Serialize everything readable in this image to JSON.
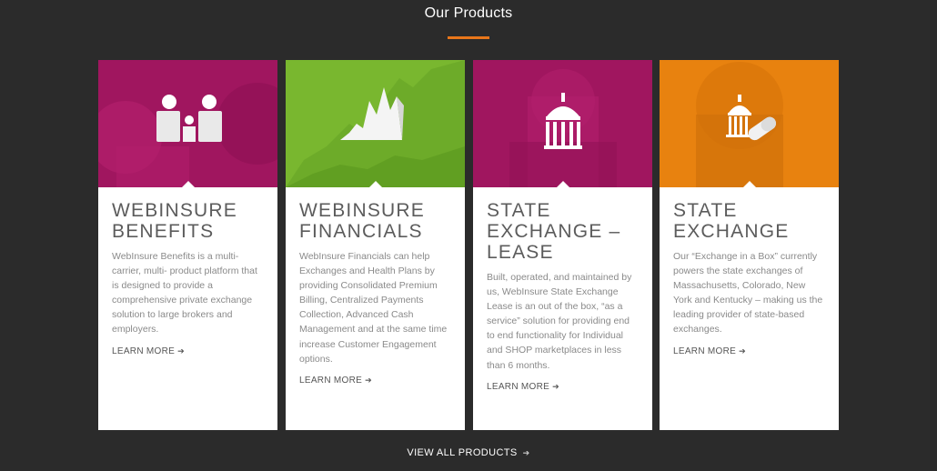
{
  "section": {
    "title": "Our Products",
    "accent_color": "#e8761a"
  },
  "cards": [
    {
      "title": "WEBINSURE\nBENEFITS",
      "description": "WebInsure Benefits is a multi-carrier, multi- product platform that is designed to provide a comprehensive private exchange solution to large brokers and employers.",
      "link_label": "LEARN MORE",
      "icon": "family-icon",
      "hero_color": "#a0165f"
    },
    {
      "title": "WEBINSURE\nFINANCIALS",
      "description": "WebInsure Financials can help Exchanges and Health Plans by providing Consolidated Premium Billing, Centralized Payments Collection, Advanced Cash Management and at the same time increase Customer Engagement options.",
      "link_label": "LEARN MORE",
      "icon": "chart-icon",
      "hero_color": "#79b72f"
    },
    {
      "title": "STATE\nEXCHANGE –\nLEASE",
      "description": "Built, operated, and maintained by us, WebInsure State Exchange Lease is an out of the box, “as a service” solution for providing end to end functionality for Individual and SHOP marketplaces in less than 6 months.",
      "link_label": "LEARN MORE",
      "icon": "capitol-icon",
      "hero_color": "#a0165f"
    },
    {
      "title": "STATE\nEXCHANGE",
      "description": "Our “Exchange in a Box” currently powers the state exchanges of Massachusetts, Colorado, New York and Kentucky – making us the leading provider of state-based exchanges.",
      "link_label": "LEARN MORE",
      "icon": "capitol-pill-icon",
      "hero_color": "#e8820f"
    }
  ],
  "footer": {
    "view_all_label": "VIEW ALL PRODUCTS"
  }
}
